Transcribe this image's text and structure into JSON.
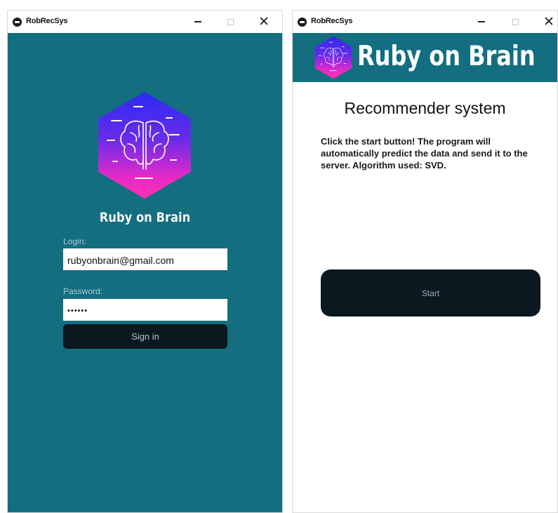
{
  "colors": {
    "brand_teal": "#136e80",
    "button_dark": "#0c1820",
    "logo_gradient": [
      "#2a2cf0",
      "#6a2bea",
      "#e52ac8",
      "#ff2fb0"
    ]
  },
  "login_window": {
    "title": "RobRecSys",
    "icons": [
      "app-icon",
      "minimize-icon",
      "maximize-icon",
      "close-icon",
      "brain-logo-icon"
    ],
    "brand_name": "Ruby on Brain",
    "login_label": "Login:",
    "login_value": "rubyonbrain@gmail.com",
    "password_label": "Password:",
    "password_value": "••••••",
    "signin_label": "Sign in"
  },
  "main_window": {
    "title": "RobRecSys",
    "brand_name": "Ruby on Brain",
    "heading": "Recommender system",
    "description": "Click the start button! The program will automatically predict the data and send it to the server. Algorithm used: SVD.",
    "start_label": "Start"
  }
}
